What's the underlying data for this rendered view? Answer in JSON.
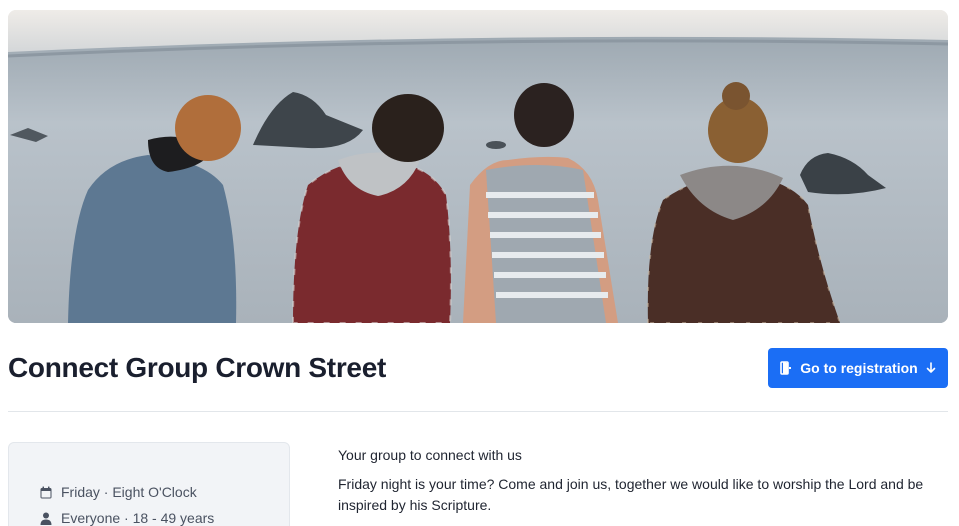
{
  "group": {
    "title": "Connect Group Crown Street",
    "description_heading": "Your group to connect with us",
    "description_body": "Friday night is your time? Come and join us, together we would like to worship the Lord and be inspired by his Scripture."
  },
  "registration": {
    "button_label": "Go to registration",
    "icons": [
      "door-icon",
      "arrow-down-icon"
    ],
    "color": "#1b6ef5"
  },
  "info": {
    "schedule": "Friday · Eight O'Clock",
    "audience": "Everyone · 18 - 49 years",
    "icons": [
      "calendar-icon",
      "person-icon"
    ]
  },
  "hero_image": {
    "alt_subject": "four-friends-sitting-by-the-sea"
  }
}
